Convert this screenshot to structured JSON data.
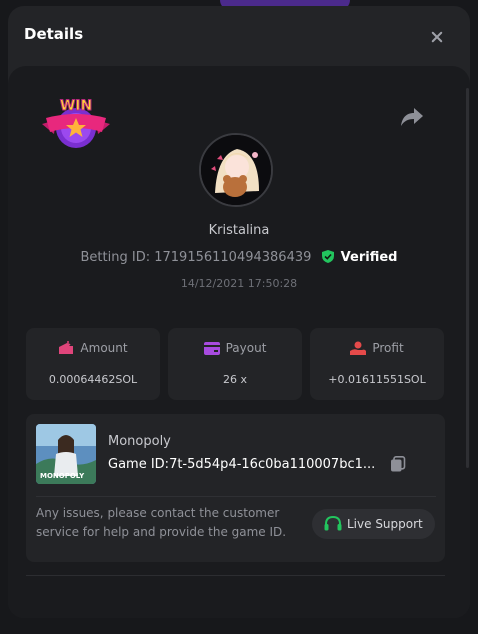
{
  "modal": {
    "title": "Details"
  },
  "bet": {
    "username": "Kristalina",
    "betting_id_label": "Betting ID:",
    "betting_id": "1719156110494386439",
    "verified_label": "Verified",
    "timestamp": "14/12/2021 17:50:28"
  },
  "stats": [
    {
      "label": "Amount",
      "value": "0.00064462SOL",
      "icon": "wallet-down-icon",
      "color": "#e0457b"
    },
    {
      "label": "Payout",
      "value": "26 x",
      "icon": "card-icon",
      "color": "#a84be0"
    },
    {
      "label": "Profit",
      "value": "+0.01611551SOL",
      "icon": "hand-coin-icon",
      "color": "#e54a4a"
    }
  ],
  "game": {
    "name": "Monopoly",
    "game_id_label": "Game ID:",
    "game_id": "7t-5d54p4-16c0ba110007bc1...",
    "thumb_text": "MONOPOLY"
  },
  "support": {
    "help_text": "Any issues, please contact the customer service for help and provide the game ID.",
    "button_label": "Live Support"
  },
  "badge": {
    "text": "WIN"
  },
  "colors": {
    "verified_green": "#22c55e",
    "support_green": "#22c55e"
  }
}
